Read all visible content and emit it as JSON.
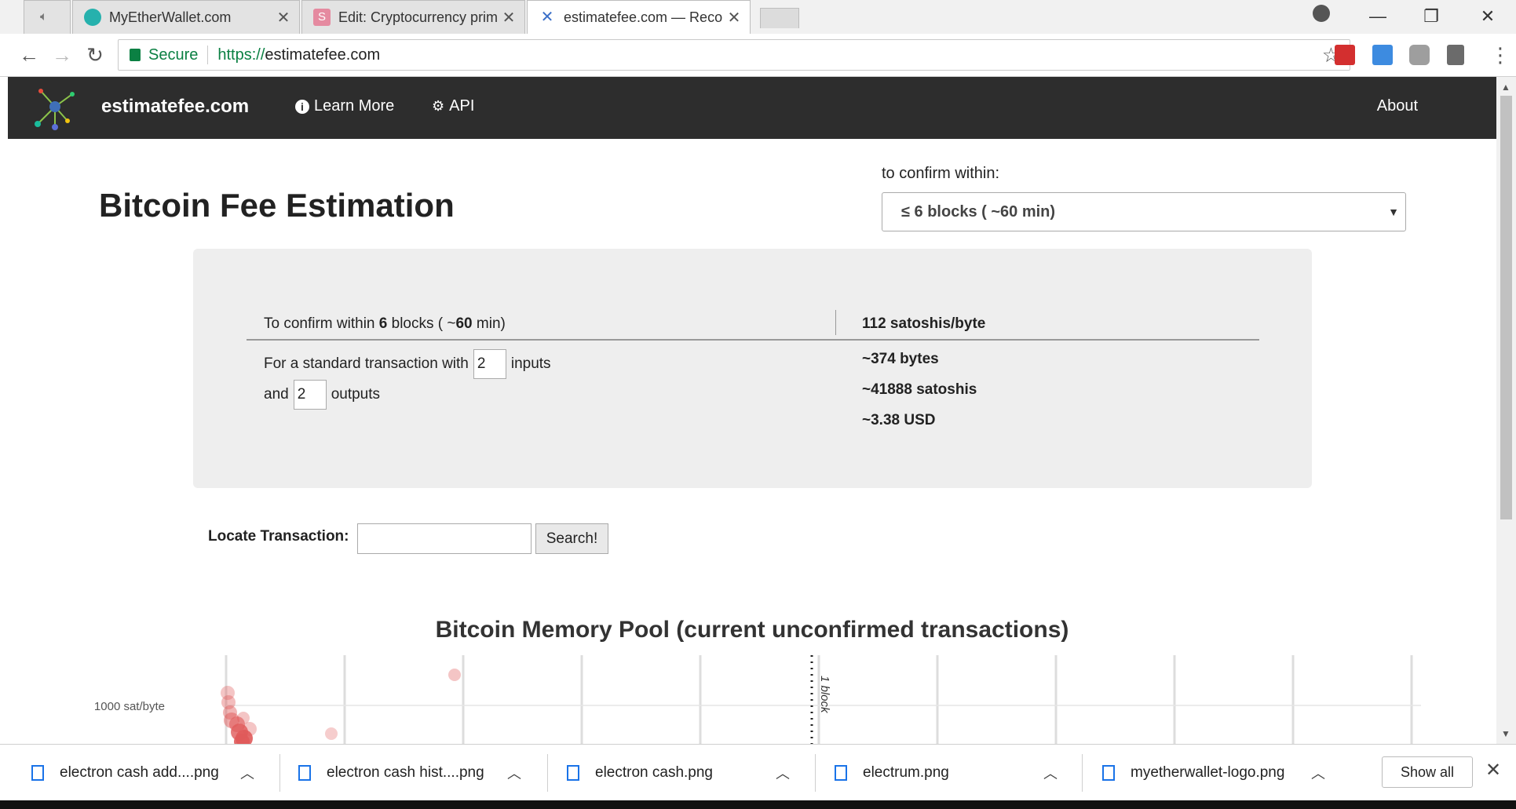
{
  "browser": {
    "tabs": [
      {
        "title": "MyEtherWallet.com"
      },
      {
        "title": "Edit: Cryptocurrency prim"
      },
      {
        "title": "estimatefee.com — Reco"
      }
    ],
    "address": {
      "secure_label": "Secure",
      "scheme": "https://",
      "host": "estimatefee.com"
    }
  },
  "site": {
    "brand": "estimatefee.com",
    "nav": {
      "learn_more": "Learn More",
      "api": "API",
      "about": "About"
    }
  },
  "main": {
    "heading": "Bitcoin Fee Estimation",
    "confirm_label": "to confirm within:",
    "confirm_selected": "≤ 6 blocks ( ~60 min)",
    "panel": {
      "confirm_prefix": "To confirm within",
      "blocks": "6",
      "blocks_word": "blocks ( ~",
      "minutes": "60",
      "minutes_suffix": "min)",
      "fee_rate": "112 satoshis/byte",
      "tx_prefix": "For a standard transaction with",
      "inputs_value": "2",
      "inputs_word": "inputs",
      "and_word": "and",
      "outputs_value": "2",
      "outputs_word": "outputs",
      "size": "~374 bytes",
      "total_sat": "~41888 satoshis",
      "total_usd": "~3.38 USD"
    },
    "locate": {
      "label": "Locate Transaction:",
      "input_value": "",
      "button": "Search!"
    }
  },
  "chart_data": {
    "type": "scatter",
    "title": "Bitcoin Memory Pool (current unconfirmed transactions)",
    "y_tick_label": "1000 sat/byte",
    "marker_label": "1 block",
    "grid": true,
    "color": "#e05a5a"
  },
  "downloads": {
    "items": [
      {
        "name": "electron cash add....png"
      },
      {
        "name": "electron cash hist....png"
      },
      {
        "name": "electron cash.png"
      },
      {
        "name": "electrum.png"
      },
      {
        "name": "myetherwallet-logo.png"
      }
    ],
    "show_all": "Show all"
  }
}
